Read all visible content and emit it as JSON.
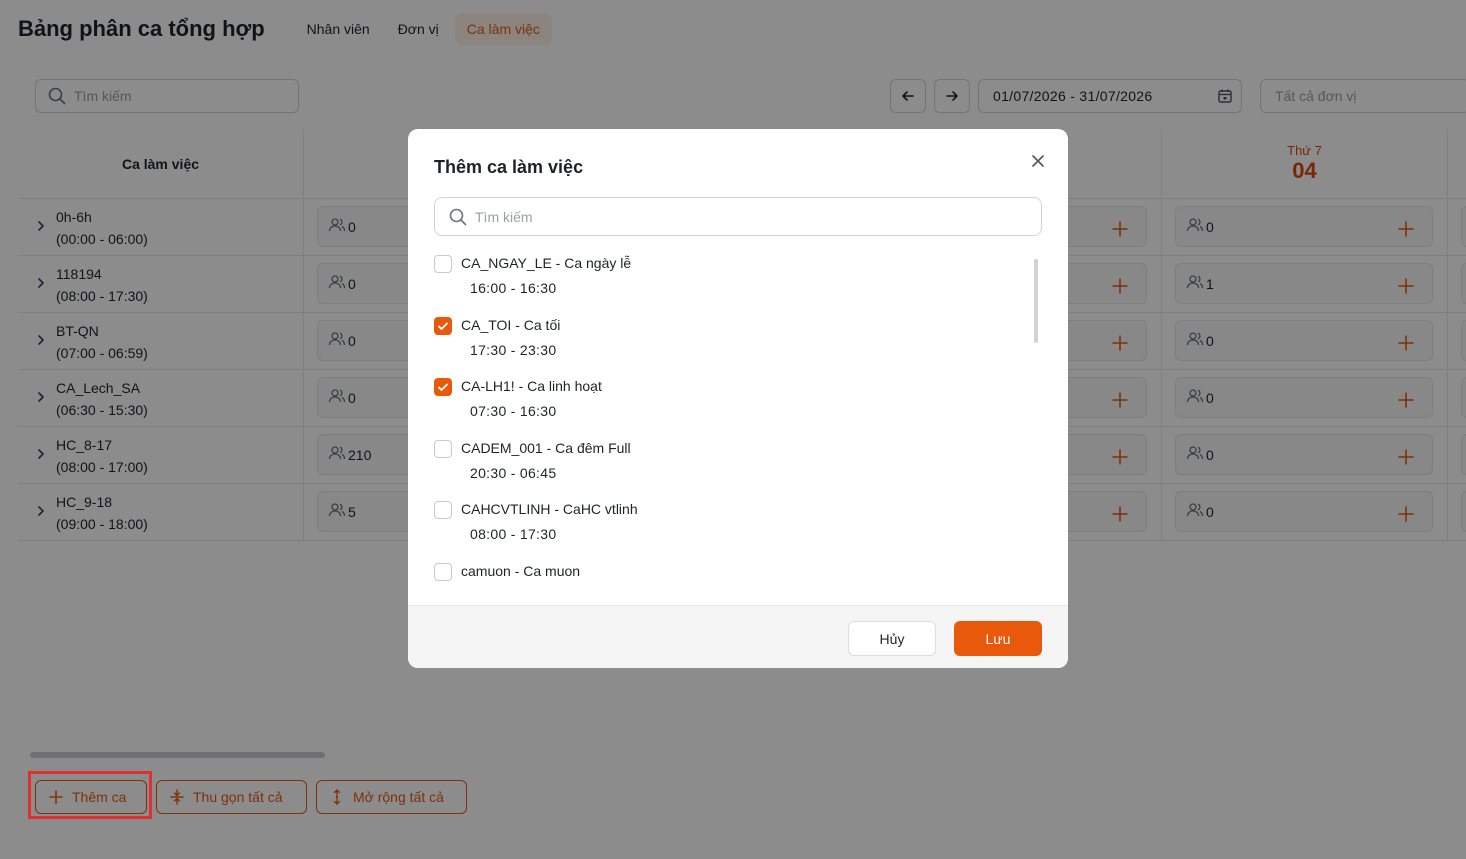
{
  "page": {
    "title": "Bảng phân ca tổng hợp",
    "tabs": [
      {
        "label": "Nhân viên",
        "active": false
      },
      {
        "label": "Đơn vị",
        "active": false
      },
      {
        "label": "Ca làm việc",
        "active": true
      }
    ]
  },
  "toolbar": {
    "search_placeholder": "Tìm kiếm",
    "date_range": "01/07/2026 - 31/07/2026",
    "unit_placeholder": "Tất cả đơn vị"
  },
  "table": {
    "shift_column_header": "Ca làm việc",
    "visible_day": {
      "weekday": "Thứ 7",
      "day": "04"
    },
    "rows": [
      {
        "name": "0h-6h",
        "time": "(00:00 - 06:00)",
        "count_left": "0",
        "count_right": "0"
      },
      {
        "name": "118194",
        "time": "(08:00 - 17:30)",
        "count_left": "0",
        "count_right": "1"
      },
      {
        "name": "BT-QN",
        "time": "(07:00 - 06:59)",
        "count_left": "0",
        "count_right": "0"
      },
      {
        "name": "CA_Lech_SA",
        "time": "(06:30 - 15:30)",
        "count_left": "0",
        "count_right": "0"
      },
      {
        "name": "HC_8-17",
        "time": "(08:00 - 17:00)",
        "count_left": "210",
        "count_right": "0"
      },
      {
        "name": "HC_9-18",
        "time": "(09:00 - 18:00)",
        "count_left": "5",
        "count_right": "0"
      }
    ]
  },
  "bottom_actions": {
    "add_shift": "Thêm ca",
    "collapse_all": "Thu gọn tất cả",
    "expand_all": "Mở rộng tất cả"
  },
  "modal": {
    "title": "Thêm ca làm việc",
    "search_placeholder": "Tìm kiếm",
    "options": [
      {
        "code": "CA_NGAY_LE",
        "name": "Ca ngày lễ",
        "time": "16:00 - 16:30",
        "checked": false
      },
      {
        "code": "CA_TOI",
        "name": "Ca tối",
        "time": "17:30 - 23:30",
        "checked": true
      },
      {
        "code": "CA-LH1!",
        "name": "Ca linh hoạt",
        "time": "07:30 - 16:30",
        "checked": true
      },
      {
        "code": "CADEM_001",
        "name": "Ca đêm Full",
        "time": "20:30 - 06:45",
        "checked": false
      },
      {
        "code": "CAHCVTLINH",
        "name": "CaHC vtlinh",
        "time": "08:00 - 17:30",
        "checked": false
      },
      {
        "code": "camuon",
        "name": "Ca muon",
        "time": "",
        "checked": false
      }
    ],
    "separator": " - ",
    "cancel_label": "Hủy",
    "save_label": "Lưu"
  },
  "colors": {
    "accent": "#e8590c",
    "highlight": "#e03131"
  }
}
